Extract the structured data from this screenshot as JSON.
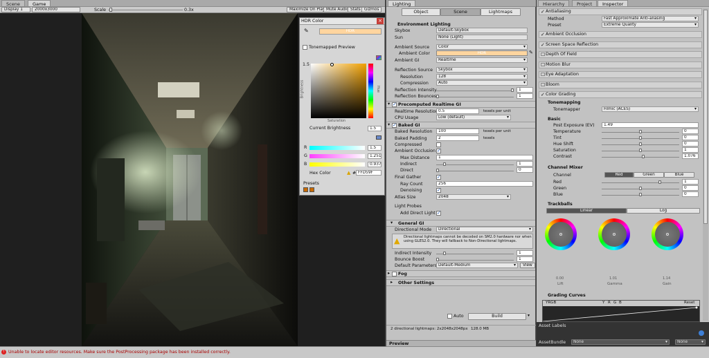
{
  "scene_tabs": {
    "scene": "Scene",
    "game": "Game"
  },
  "game_toolbar": {
    "display": "Display 1",
    "resolution": "2000x3000",
    "scale_label": "Scale",
    "scale_value": "0.3x",
    "maximize": "Maximize On Play",
    "mute": "Mute Audio",
    "stats": "Stats",
    "gizmos": "Gizmos"
  },
  "hdr_color": {
    "title": "HDR Color",
    "swatch_text": "HDR",
    "tonemapped": "Tonemapped Preview",
    "top_value": "1.5",
    "brightness_axis": "Brightness",
    "saturation_axis": "Saturation",
    "hue_axis": "Hue",
    "current_brightness_label": "Current Brightness",
    "current_brightness_value": "1.5",
    "r_label": "R",
    "r_value": "1.5",
    "g_label": "G",
    "g_value": "1.251",
    "b_label": "B",
    "b_value": "0.937",
    "hex_label": "Hex Color",
    "hex_value": "FFD59F",
    "presets": "Presets"
  },
  "lighting": {
    "tab": "Lighting",
    "tabs": [
      "Object",
      "Scene",
      "Lightmaps"
    ],
    "env_title": "Environment Lighting",
    "skybox_label": "Skybox",
    "skybox_value": "Default-Skybox",
    "sun_label": "Sun",
    "sun_value": "None (Light)",
    "ambient_source_label": "Ambient Source",
    "ambient_source_value": "Color",
    "ambient_color_label": "Ambient Color",
    "ambient_color_text": "HDR",
    "ambient_gi_label": "Ambient GI",
    "ambient_gi_value": "Realtime",
    "reflection_source_label": "Reflection Source",
    "reflection_source_value": "Skybox",
    "resolution_label": "Resolution",
    "resolution_value": "128",
    "compression_label": "Compression",
    "compression_value": "Auto",
    "refl_intensity_label": "Reflection Intensity",
    "refl_intensity_value": "1",
    "refl_bounces_label": "Reflection Bounces",
    "refl_bounces_value": "1",
    "precomp_title": "Precomputed Realtime GI",
    "rt_res_label": "Realtime Resolution",
    "rt_res_value": "0.5",
    "rt_res_unit": "texels per unit",
    "cpu_label": "CPU Usage",
    "cpu_value": "Low (default)",
    "baked_title": "Baked GI",
    "baked_res_label": "Baked Resolution",
    "baked_res_value": "100",
    "baked_res_unit": "texels per unit",
    "baked_pad_label": "Baked Padding",
    "baked_pad_value": "2",
    "baked_pad_unit": "texels",
    "compressed_label": "Compressed",
    "ao_label": "Ambient Occlusion",
    "max_dist_label": "Max Distance",
    "max_dist_value": "1",
    "indirect_label": "Indirect",
    "indirect_value": "1",
    "direct_label": "Direct",
    "direct_value": "0",
    "fg_label": "Final Gather",
    "ray_label": "Ray Count",
    "ray_value": "256",
    "denoise_label": "Denoising",
    "atlas_label": "Atlas Size",
    "atlas_value": "2048",
    "probes_label": "Light Probes",
    "add_direct_label": "Add Direct Light",
    "general_title": "General GI",
    "dir_mode_label": "Directional Mode",
    "dir_mode_value": "Directional",
    "warning": "Directional lightmaps cannot be decoded on SM2.0 hardware nor when using GLES2.0. They will fallback to Non-Directional lightmaps.",
    "ind_int_label": "Indirect Intensity",
    "ind_int_value": "1",
    "bounce_label": "Bounce Boost",
    "bounce_value": "1",
    "def_params_label": "Default Parameters",
    "def_params_value": "Default-Medium",
    "view": "View",
    "fog_title": "Fog",
    "other_title": "Other Settings",
    "auto_label": "Auto",
    "build": "Build",
    "summary": "2 directional lightmaps: 2x2048x2048px",
    "summary_size": "128.0 MB",
    "preview": "Preview"
  },
  "inspector": {
    "tabs": [
      "Hierarchy",
      "Project",
      "Inspector"
    ],
    "aa_title": "Antialiasing",
    "method_label": "Method",
    "method_value": "Fast Approximate Anti-aliasing",
    "preset_label": "Preset",
    "preset_value": "Extreme Quality",
    "effects": [
      "Ambient Occlusion",
      "Screen Space Reflection",
      "Depth Of Field",
      "Motion Blur",
      "Eye Adaptation",
      "Bloom",
      "Color Grading"
    ],
    "tonemap_title": "Tonemapping",
    "tonemapper_label": "Tonemapper",
    "tonemapper_value": "Filmic (ACES)",
    "basic_title": "Basic",
    "post_exp_label": "Post Exposure (EV)",
    "post_exp_value": "1.49",
    "temp_label": "Temperature",
    "temp_value": "0",
    "tint_label": "Tint",
    "tint_value": "0",
    "hue_label": "Hue Shift",
    "hue_value": "0",
    "sat_label": "Saturation",
    "sat_value": "1",
    "contrast_label": "Contrast",
    "contrast_value": "1.076",
    "mixer_title": "Channel Mixer",
    "channel_label": "Channel",
    "channel_tabs": [
      "Red",
      "Green",
      "Blue"
    ],
    "red_label": "Red",
    "red_value": "1",
    "green_label": "Green",
    "green_value": "0",
    "blue_label": "Blue",
    "blue_value": "0",
    "trackballs_title": "Trackballs",
    "track_tabs": [
      "Linear",
      "Log"
    ],
    "wheel_labels": [
      "Lift",
      "Gamma",
      "Gain"
    ],
    "wheel_vals": [
      "0.00",
      "1.01",
      "1.14"
    ],
    "curves_title": "Grading Curves",
    "curve_tabs": [
      "YRGB",
      "Y",
      "R",
      "G",
      "B"
    ],
    "reset": "Reset",
    "asset_labels": "Asset Labels",
    "asset_bundle_label": "AssetBundle",
    "asset_bundle_value": "None",
    "asset_variant_value": "None"
  },
  "status": {
    "error": "Unable to locate editor resources. Make sure the PostProcessing package has been installed correctly."
  }
}
